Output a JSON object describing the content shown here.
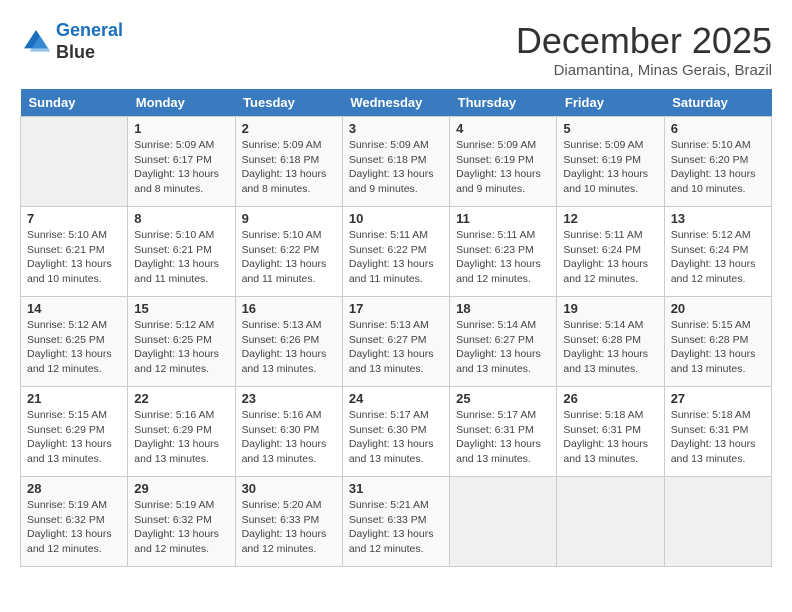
{
  "logo": {
    "line1": "General",
    "line2": "Blue"
  },
  "title": "December 2025",
  "subtitle": "Diamantina, Minas Gerais, Brazil",
  "weekdays": [
    "Sunday",
    "Monday",
    "Tuesday",
    "Wednesday",
    "Thursday",
    "Friday",
    "Saturday"
  ],
  "weeks": [
    [
      {
        "day": "",
        "empty": true
      },
      {
        "day": "1",
        "sunrise": "5:09 AM",
        "sunset": "6:17 PM",
        "daylight": "13 hours and 8 minutes."
      },
      {
        "day": "2",
        "sunrise": "5:09 AM",
        "sunset": "6:18 PM",
        "daylight": "13 hours and 8 minutes."
      },
      {
        "day": "3",
        "sunrise": "5:09 AM",
        "sunset": "6:18 PM",
        "daylight": "13 hours and 9 minutes."
      },
      {
        "day": "4",
        "sunrise": "5:09 AM",
        "sunset": "6:19 PM",
        "daylight": "13 hours and 9 minutes."
      },
      {
        "day": "5",
        "sunrise": "5:09 AM",
        "sunset": "6:19 PM",
        "daylight": "13 hours and 10 minutes."
      },
      {
        "day": "6",
        "sunrise": "5:10 AM",
        "sunset": "6:20 PM",
        "daylight": "13 hours and 10 minutes."
      }
    ],
    [
      {
        "day": "7",
        "sunrise": "5:10 AM",
        "sunset": "6:21 PM",
        "daylight": "13 hours and 10 minutes."
      },
      {
        "day": "8",
        "sunrise": "5:10 AM",
        "sunset": "6:21 PM",
        "daylight": "13 hours and 11 minutes."
      },
      {
        "day": "9",
        "sunrise": "5:10 AM",
        "sunset": "6:22 PM",
        "daylight": "13 hours and 11 minutes."
      },
      {
        "day": "10",
        "sunrise": "5:11 AM",
        "sunset": "6:22 PM",
        "daylight": "13 hours and 11 minutes."
      },
      {
        "day": "11",
        "sunrise": "5:11 AM",
        "sunset": "6:23 PM",
        "daylight": "13 hours and 12 minutes."
      },
      {
        "day": "12",
        "sunrise": "5:11 AM",
        "sunset": "6:24 PM",
        "daylight": "13 hours and 12 minutes."
      },
      {
        "day": "13",
        "sunrise": "5:12 AM",
        "sunset": "6:24 PM",
        "daylight": "13 hours and 12 minutes."
      }
    ],
    [
      {
        "day": "14",
        "sunrise": "5:12 AM",
        "sunset": "6:25 PM",
        "daylight": "13 hours and 12 minutes."
      },
      {
        "day": "15",
        "sunrise": "5:12 AM",
        "sunset": "6:25 PM",
        "daylight": "13 hours and 12 minutes."
      },
      {
        "day": "16",
        "sunrise": "5:13 AM",
        "sunset": "6:26 PM",
        "daylight": "13 hours and 13 minutes."
      },
      {
        "day": "17",
        "sunrise": "5:13 AM",
        "sunset": "6:27 PM",
        "daylight": "13 hours and 13 minutes."
      },
      {
        "day": "18",
        "sunrise": "5:14 AM",
        "sunset": "6:27 PM",
        "daylight": "13 hours and 13 minutes."
      },
      {
        "day": "19",
        "sunrise": "5:14 AM",
        "sunset": "6:28 PM",
        "daylight": "13 hours and 13 minutes."
      },
      {
        "day": "20",
        "sunrise": "5:15 AM",
        "sunset": "6:28 PM",
        "daylight": "13 hours and 13 minutes."
      }
    ],
    [
      {
        "day": "21",
        "sunrise": "5:15 AM",
        "sunset": "6:29 PM",
        "daylight": "13 hours and 13 minutes."
      },
      {
        "day": "22",
        "sunrise": "5:16 AM",
        "sunset": "6:29 PM",
        "daylight": "13 hours and 13 minutes."
      },
      {
        "day": "23",
        "sunrise": "5:16 AM",
        "sunset": "6:30 PM",
        "daylight": "13 hours and 13 minutes."
      },
      {
        "day": "24",
        "sunrise": "5:17 AM",
        "sunset": "6:30 PM",
        "daylight": "13 hours and 13 minutes."
      },
      {
        "day": "25",
        "sunrise": "5:17 AM",
        "sunset": "6:31 PM",
        "daylight": "13 hours and 13 minutes."
      },
      {
        "day": "26",
        "sunrise": "5:18 AM",
        "sunset": "6:31 PM",
        "daylight": "13 hours and 13 minutes."
      },
      {
        "day": "27",
        "sunrise": "5:18 AM",
        "sunset": "6:31 PM",
        "daylight": "13 hours and 13 minutes."
      }
    ],
    [
      {
        "day": "28",
        "sunrise": "5:19 AM",
        "sunset": "6:32 PM",
        "daylight": "13 hours and 12 minutes."
      },
      {
        "day": "29",
        "sunrise": "5:19 AM",
        "sunset": "6:32 PM",
        "daylight": "13 hours and 12 minutes."
      },
      {
        "day": "30",
        "sunrise": "5:20 AM",
        "sunset": "6:33 PM",
        "daylight": "13 hours and 12 minutes."
      },
      {
        "day": "31",
        "sunrise": "5:21 AM",
        "sunset": "6:33 PM",
        "daylight": "13 hours and 12 minutes."
      },
      {
        "day": "",
        "empty": true
      },
      {
        "day": "",
        "empty": true
      },
      {
        "day": "",
        "empty": true
      }
    ]
  ]
}
